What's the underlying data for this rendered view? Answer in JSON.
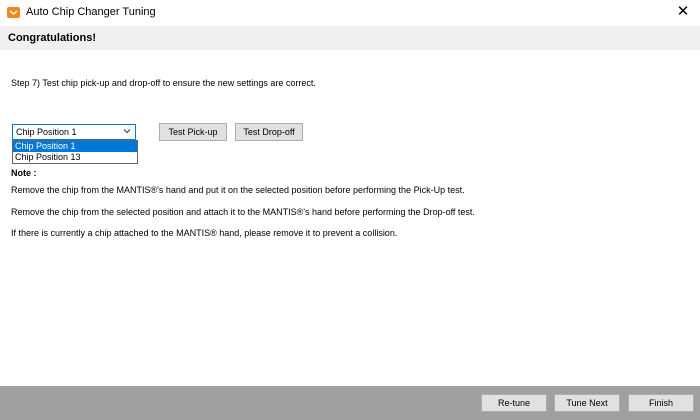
{
  "window": {
    "title": "Auto Chip Changer Tuning",
    "close_glyph": "✕",
    "icon": "app-icon"
  },
  "header": {
    "title": "Congratulations!"
  },
  "step": {
    "text": "Step 7) Test chip pick-up and drop-off to ensure the new settings are correct."
  },
  "position_select": {
    "value": "Chip Position 1",
    "options": [
      "Chip Position 1",
      "Chip Position 13"
    ],
    "selected_index": 0,
    "expanded": true
  },
  "buttons": {
    "pickup": "Test Pick-up",
    "dropoff": "Test Drop-off"
  },
  "note": {
    "label": "Note :",
    "lines": [
      "Remove the chip from the MANTIS®'s hand and put it on the selected position before performing the Pick-Up test.",
      "Remove the chip from the selected position and attach it to the MANTIS®'s hand before performing the Drop-off test.",
      "If there is currently a chip attached to the MANTIS® hand, please remove it to prevent a collision."
    ]
  },
  "footer": {
    "retune": "Re-tune",
    "tune_next": "Tune Next",
    "finish": "Finish"
  },
  "colors": {
    "accent": "#0078d7",
    "header_band": "#f0f0f0",
    "footer": "#a0a0a0",
    "button_face": "#e1e1e1",
    "app_icon": "#f08a1c"
  }
}
